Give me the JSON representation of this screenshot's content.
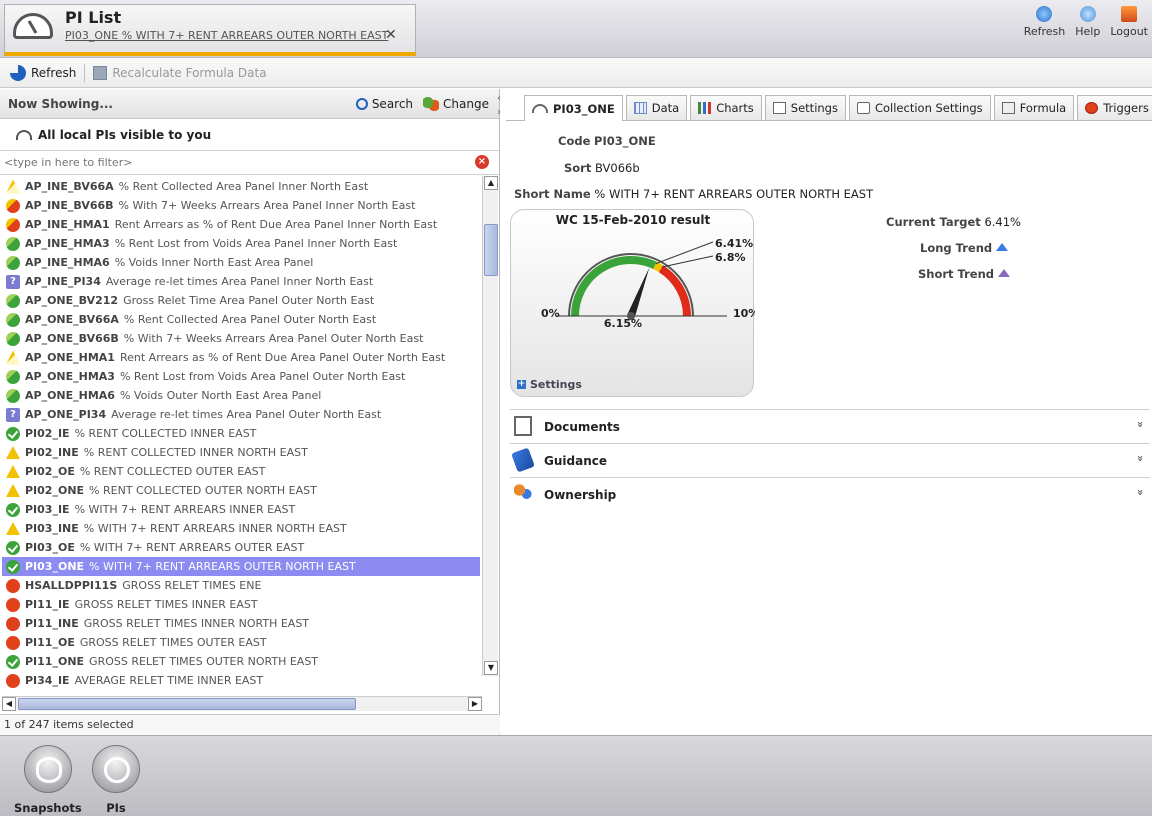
{
  "header": {
    "app_title": "PI List",
    "doc_subtitle": "PI03_ONE % WITH 7+ RENT ARREARS OUTER NORTH EAST",
    "close_glyph": "✕",
    "actions": [
      {
        "label": "Refresh",
        "icon": "refresh-icon"
      },
      {
        "label": "Help",
        "icon": "help-icon"
      },
      {
        "label": "Logout",
        "icon": "logout-icon"
      }
    ]
  },
  "toolbar": {
    "refresh_label": "Refresh",
    "recalc_label": "Recalculate Formula Data"
  },
  "left": {
    "now_showing": "Now Showing...",
    "search_label": "Search",
    "change_label": "Change",
    "scope": "All local PIs visible to you",
    "filter_placeholder": "<type in here to filter>",
    "status": "1 of 247 items selected",
    "items": [
      {
        "code": "AP_INE_BV66A",
        "desc": "% Rent Collected Area Panel Inner North East",
        "status": "amber-combo",
        "selected": false
      },
      {
        "code": "AP_INE_BV66B",
        "desc": "% With 7+ Weeks Arrears Area Panel Inner North East",
        "status": "red-combo",
        "selected": false
      },
      {
        "code": "AP_INE_HMA1",
        "desc": "Rent Arrears as % of Rent Due Area Panel Inner North East",
        "status": "red-combo",
        "selected": false
      },
      {
        "code": "AP_INE_HMA3",
        "desc": "% Rent Lost from Voids Area Panel Inner North East",
        "status": "green-combo",
        "selected": false
      },
      {
        "code": "AP_INE_HMA6",
        "desc": "% Voids Inner North East Area Panel",
        "status": "green-combo",
        "selected": false
      },
      {
        "code": "AP_INE_PI34",
        "desc": "Average re-let times Area Panel Inner North East",
        "status": "info",
        "selected": false
      },
      {
        "code": "AP_ONE_BV212",
        "desc": "Gross Relet Time Area Panel Outer North East",
        "status": "green-combo",
        "selected": false
      },
      {
        "code": "AP_ONE_BV66A",
        "desc": "% Rent Collected Area Panel Outer North East",
        "status": "green-combo",
        "selected": false
      },
      {
        "code": "AP_ONE_BV66B",
        "desc": "% With 7+ Weeks Arrears Area Panel Outer North East",
        "status": "green-combo",
        "selected": false
      },
      {
        "code": "AP_ONE_HMA1",
        "desc": "Rent Arrears as % of Rent Due Area Panel Outer North East",
        "status": "amber-combo",
        "selected": false
      },
      {
        "code": "AP_ONE_HMA3",
        "desc": "% Rent Lost from Voids Area Panel Outer North East",
        "status": "green-combo",
        "selected": false
      },
      {
        "code": "AP_ONE_HMA6",
        "desc": "% Voids Outer North East Area Panel",
        "status": "green-combo",
        "selected": false
      },
      {
        "code": "AP_ONE_PI34",
        "desc": "Average re-let times Area Panel Outer North East",
        "status": "info",
        "selected": false
      },
      {
        "code": "PI02_IE",
        "desc": "% RENT COLLECTED INNER EAST",
        "status": "green",
        "selected": false
      },
      {
        "code": "PI02_INE",
        "desc": "% RENT COLLECTED INNER NORTH EAST",
        "status": "amber",
        "selected": false
      },
      {
        "code": "PI02_OE",
        "desc": "% RENT COLLECTED OUTER EAST",
        "status": "amber",
        "selected": false
      },
      {
        "code": "PI02_ONE",
        "desc": "% RENT COLLECTED OUTER NORTH EAST",
        "status": "amber",
        "selected": false
      },
      {
        "code": "PI03_IE",
        "desc": "% WITH 7+ RENT ARREARS INNER EAST",
        "status": "green",
        "selected": false
      },
      {
        "code": "PI03_INE",
        "desc": "% WITH 7+ RENT ARREARS INNER NORTH EAST",
        "status": "amber",
        "selected": false
      },
      {
        "code": "PI03_OE",
        "desc": "% WITH 7+ RENT ARREARS OUTER EAST",
        "status": "green",
        "selected": false
      },
      {
        "code": "PI03_ONE",
        "desc": "% WITH 7+ RENT ARREARS OUTER NORTH EAST",
        "status": "green",
        "selected": true
      },
      {
        "code": "HSALLDPPI11S",
        "desc": "GROSS RELET TIMES ENE",
        "status": "red",
        "selected": false
      },
      {
        "code": "PI11_IE",
        "desc": "GROSS RELET TIMES INNER EAST",
        "status": "red",
        "selected": false
      },
      {
        "code": "PI11_INE",
        "desc": "GROSS RELET TIMES INNER NORTH EAST",
        "status": "red",
        "selected": false
      },
      {
        "code": "PI11_OE",
        "desc": "GROSS RELET TIMES OUTER EAST",
        "status": "red",
        "selected": false
      },
      {
        "code": "PI11_ONE",
        "desc": "GROSS RELET TIMES OUTER NORTH EAST",
        "status": "green",
        "selected": false
      },
      {
        "code": "PI34_IE",
        "desc": "AVERAGE RELET TIME INNER EAST",
        "status": "red",
        "selected": false
      }
    ]
  },
  "right": {
    "tabs": [
      {
        "label": "PI03_ONE",
        "icon": "gauge-icon",
        "active": true
      },
      {
        "label": "Data",
        "icon": "grid-icon",
        "active": false
      },
      {
        "label": "Charts",
        "icon": "bar-chart-icon",
        "active": false
      },
      {
        "label": "Settings",
        "icon": "checklist-icon",
        "active": false
      },
      {
        "label": "Collection Settings",
        "icon": "calendar-icon",
        "active": false
      },
      {
        "label": "Formula",
        "icon": "formula-icon",
        "active": false
      },
      {
        "label": "Triggers",
        "icon": "clock-icon",
        "active": false
      }
    ],
    "code_key": "Code",
    "code_value": "PI03_ONE",
    "sort_key": "Sort",
    "sort_value": "BV066b",
    "short_name_key": "Short Name",
    "short_name_value": "% WITH 7+ RENT ARREARS OUTER NORTH EAST",
    "gauge": {
      "title": "WC 15-Feb-2010 result",
      "value": 6.15,
      "value_label": "6.15%",
      "min": 0,
      "max": 10,
      "min_label": "0%",
      "max_label": "10%",
      "target": 6.41,
      "target_label": "6.41%",
      "threshold": 6.8,
      "threshold_label": "6.8%",
      "settings_label": "Settings",
      "colors": {
        "green": "#3aa33a",
        "amber": "#f2c200",
        "red": "#e02a1a"
      }
    },
    "current_target_key": "Current Target",
    "current_target_value": "6.41%",
    "long_trend_key": "Long Trend",
    "short_trend_key": "Short Trend",
    "sections": [
      {
        "label": "Documents",
        "icon": "documents-icon",
        "chevron": "»"
      },
      {
        "label": "Guidance",
        "icon": "guidance-icon",
        "chevron": "»"
      },
      {
        "label": "Ownership",
        "icon": "ownership-icon",
        "chevron": "»"
      }
    ]
  },
  "dock": {
    "snapshots_label": "Snapshots",
    "pis_label": "PIs"
  },
  "colors": {
    "selected_row": "#8b8bf2",
    "tab_accent": "#f0a800"
  }
}
